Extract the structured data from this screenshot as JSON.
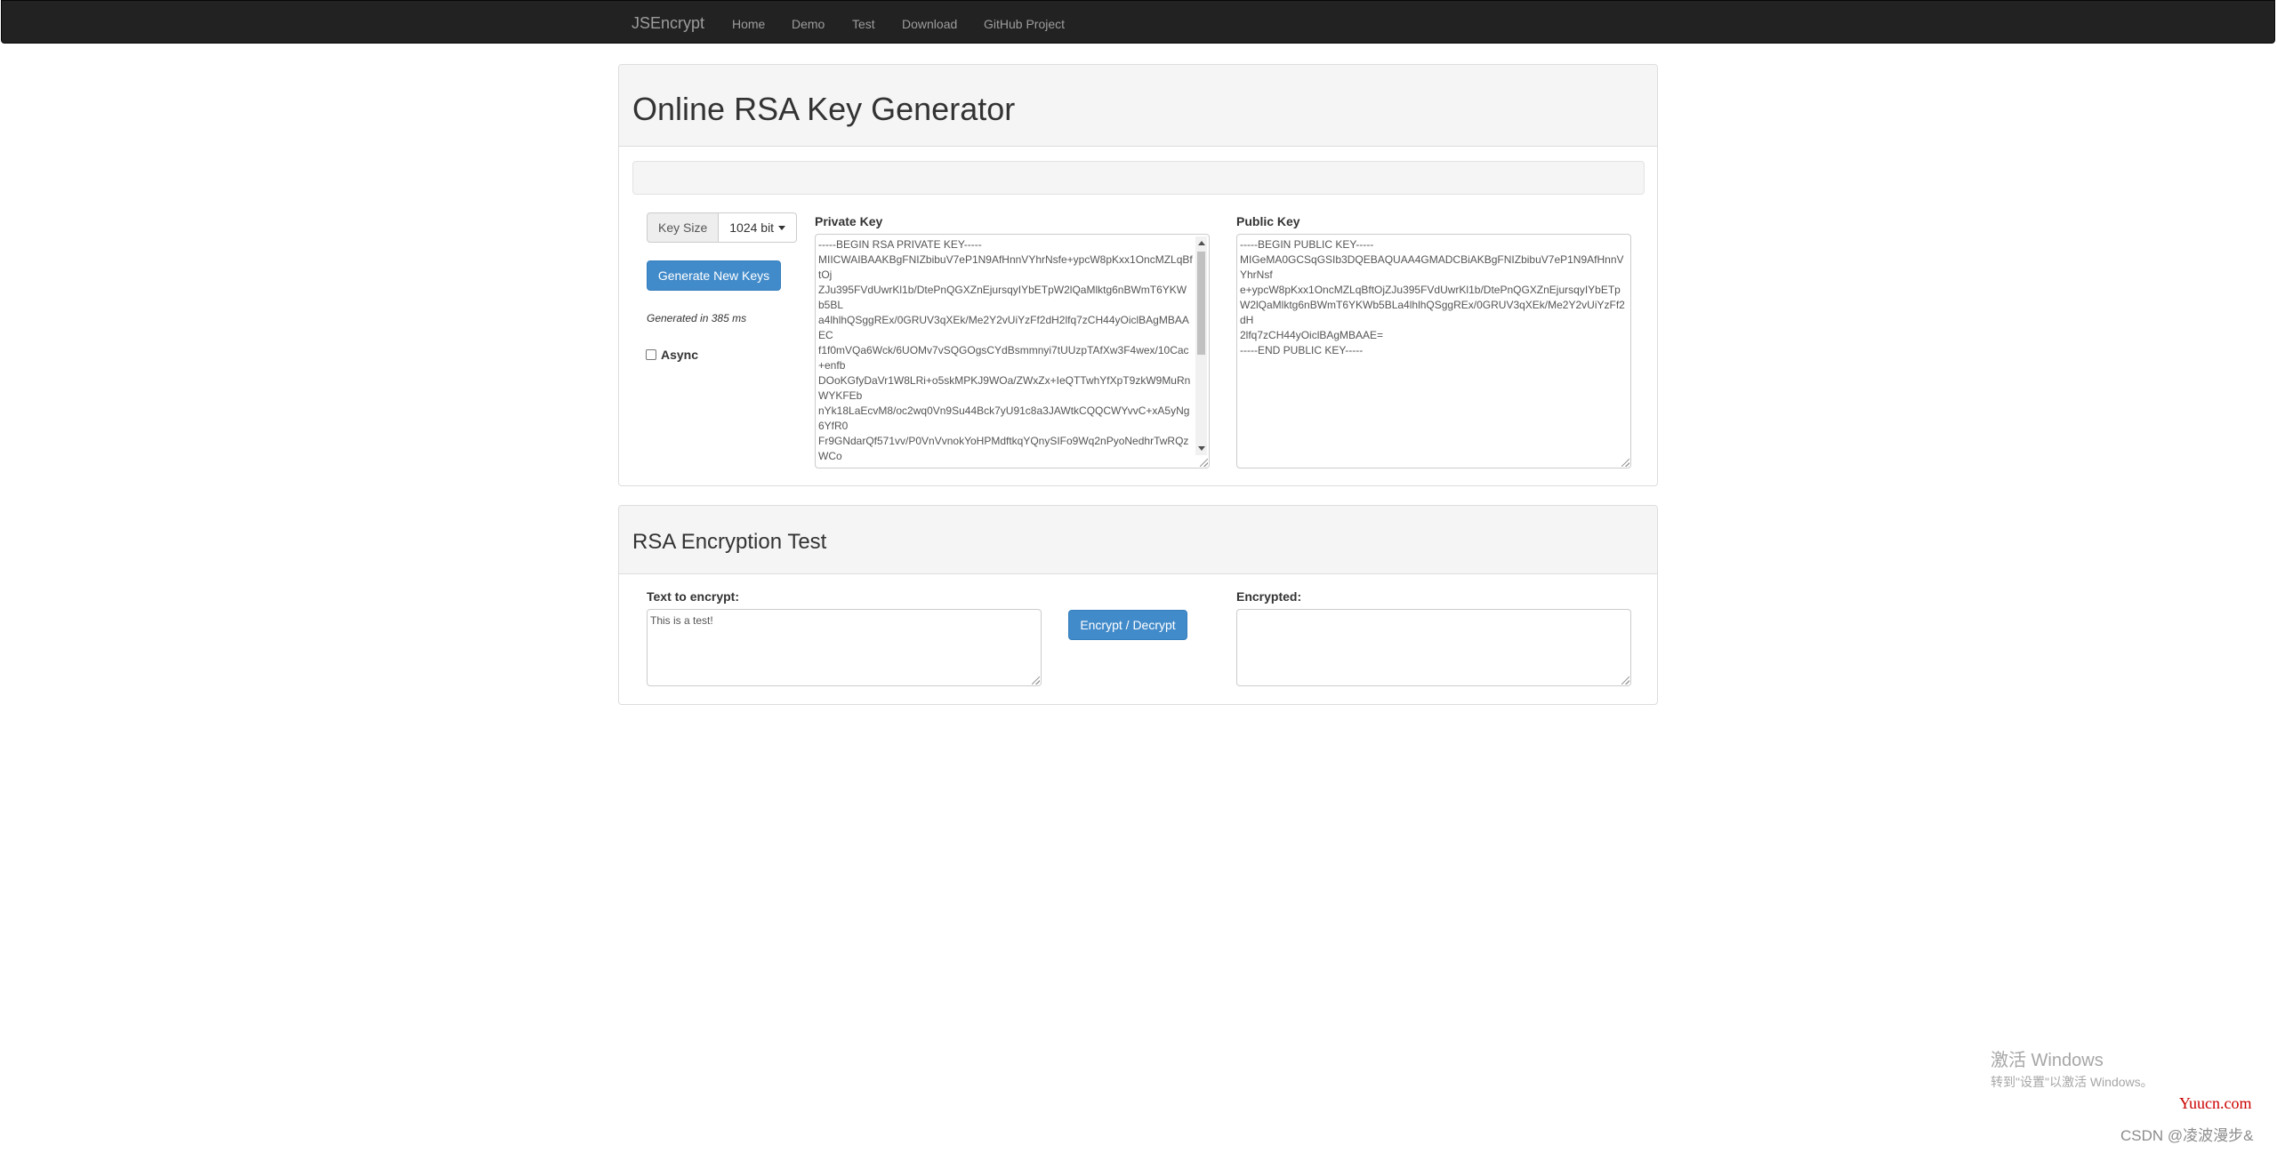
{
  "navbar": {
    "brand": "JSEncrypt",
    "items": [
      "Home",
      "Demo",
      "Test",
      "Download",
      "GitHub Project"
    ]
  },
  "generator": {
    "title": "Online RSA Key Generator",
    "key_size_label": "Key Size",
    "key_size_value": "1024 bit",
    "generate_button": "Generate New Keys",
    "generated_text": "Generated in 385 ms",
    "async_label": "Async",
    "private_key_label": "Private Key",
    "private_key_value": "-----BEGIN RSA PRIVATE KEY-----\nMIICWAIBAAKBgFNIZbibuV7eP1N9AfHnnVYhrNsfe+ypcW8pKxx1OncMZLqBf\ntOj\nZJu395FVdUwrKl1b/DtePnQGXZnEjursqyIYbETpW2lQaMlktg6nBWmT6YKW\nb5BL\na4lhlhQSggREx/0GRUV3qXEk/Me2Y2vUiYzFf2dH2lfq7zCH44yOiclBAgMBAA\nEC\nf1f0mVQa6Wck/6UOMv7vSQGOgsCYdBsmmnyi7tUUzpTAfXw3F4wex/10Cac\n+enfb\nDOoKGfyDaVr1W8LRi+o5skMPKJ9WOa/ZWxZx+IeQTTwhYfXpT9zkW9MuRn\nWYKFEb\nnYk18LaEcvM8/oc2wq0Vn9Su44Bck7yU91c8a3JAWtkCQQCWYvvC+xA5yNg\n6YfR0\nFr9GNdarQf571vv/P0VnVvnokYoHPMdftkqYQnySIFo9Wq2nPyoNedhrTwRQz\nWCo",
    "public_key_label": "Public Key",
    "public_key_value": "-----BEGIN PUBLIC KEY-----\nMIGeMA0GCSqGSIb3DQEBAQUAA4GMADCBiAKBgFNIZbibuV7eP1N9AfHnnV\nYhrNsf\ne+ypcW8pKxx1OncMZLqBftOjZJu395FVdUwrKl1b/DtePnQGXZnEjursqyIYbETp\nW2lQaMlktg6nBWmT6YKWb5BLa4lhlhQSggREx/0GRUV3qXEk/Me2Y2vUiYzFf2\ndH\n2lfq7zCH44yOiclBAgMBAAE=\n-----END PUBLIC KEY-----"
  },
  "encryption": {
    "title": "RSA Encryption Test",
    "input_label": "Text to encrypt:",
    "input_value": "This is a test!",
    "button": "Encrypt / Decrypt",
    "output_label": "Encrypted:",
    "output_value": ""
  },
  "watermark": {
    "title": "激活 Windows",
    "subtitle": "转到\"设置\"以激活 Windows。",
    "site": "Yuucn.com",
    "credit": "CSDN @凌波漫步&"
  },
  "colors": {
    "navbar_bg": "#222222",
    "primary_button": "#428bca",
    "panel_heading_bg": "#f5f5f5"
  }
}
